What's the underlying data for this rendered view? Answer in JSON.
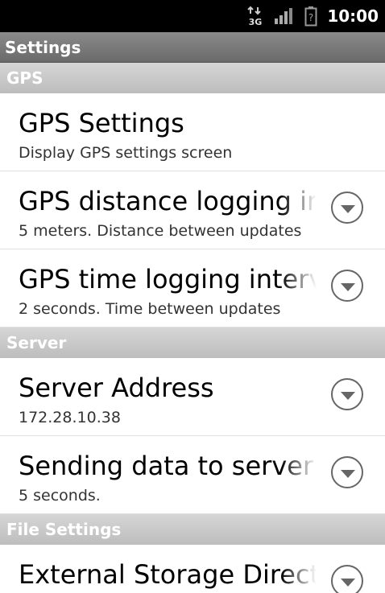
{
  "status_bar": {
    "network": "3G",
    "time": "10:00",
    "icons": [
      "network-3g-icon",
      "signal-icon",
      "battery-unknown-icon"
    ]
  },
  "title": "Settings",
  "sections": [
    {
      "header": "GPS",
      "items": [
        {
          "title": "GPS Settings",
          "summary": "Display GPS settings screen",
          "has_dropdown": false
        },
        {
          "title": "GPS distance logging interval",
          "summary": "5 meters. Distance between updates",
          "has_dropdown": true
        },
        {
          "title": "GPS time logging interval",
          "summary": "2 seconds. Time between updates",
          "has_dropdown": true
        }
      ]
    },
    {
      "header": "Server",
      "items": [
        {
          "title": "Server Address",
          "summary": "172.28.10.38",
          "has_dropdown": true
        },
        {
          "title": "Sending data to server interval",
          "summary": "5 seconds.",
          "has_dropdown": true
        }
      ]
    },
    {
      "header": "File Settings",
      "items": [
        {
          "title": "External Storage Directory",
          "summary": "",
          "has_dropdown": true
        }
      ]
    }
  ]
}
